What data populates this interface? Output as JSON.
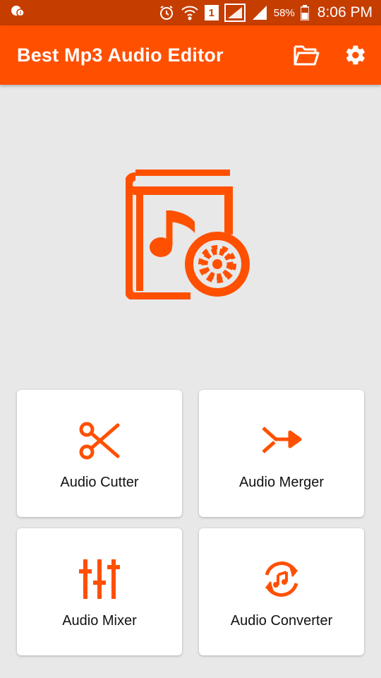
{
  "status_bar": {
    "sim_slot": "1",
    "battery_percent": "58%",
    "time": "8:06 PM"
  },
  "app_bar": {
    "title": "Best Mp3 Audio Editor",
    "actions": [
      "folder-icon",
      "gear-icon"
    ]
  },
  "hero": {
    "icon": "music-book-gear-icon"
  },
  "tiles": [
    {
      "label": "Audio Cutter",
      "icon": "scissors-icon"
    },
    {
      "label": "Audio Merger",
      "icon": "merge-arrow-icon"
    },
    {
      "label": "Audio Mixer",
      "icon": "sliders-icon"
    },
    {
      "label": "Audio Converter",
      "icon": "music-sync-icon"
    }
  ],
  "colors": {
    "status_bar": "#c63d00",
    "app_bar": "#ff5000",
    "accent": "#ff5000",
    "background": "#e8e8e8"
  }
}
